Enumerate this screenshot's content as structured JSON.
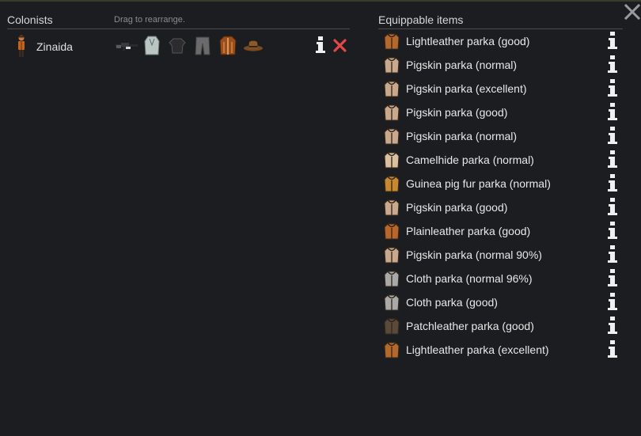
{
  "header": {
    "close_icon": "close-icon"
  },
  "colonists_panel": {
    "title": "Colonists",
    "hint": "Drag to rearrange.",
    "colonists": [
      {
        "name": "Zinaida",
        "gear_icons": [
          "rifle-icon",
          "vest-icon",
          "shirt-icon",
          "pants-icon",
          "parka-icon",
          "cowboy-hat-icon"
        ]
      }
    ]
  },
  "items_panel": {
    "title": "Equippable items",
    "items": [
      {
        "label": "Lightleather parka (good)",
        "color": "#b4692c"
      },
      {
        "label": "Pigskin parka (normal)",
        "color": "#c9a98d"
      },
      {
        "label": "Pigskin parka (excellent)",
        "color": "#c9a98d"
      },
      {
        "label": "Pigskin parka (good)",
        "color": "#c9a98d"
      },
      {
        "label": "Pigskin parka (normal)",
        "color": "#c9a98d"
      },
      {
        "label": "Camelhide parka (normal)",
        "color": "#d8c0a0"
      },
      {
        "label": "Guinea pig fur parka (normal)",
        "color": "#c6892f"
      },
      {
        "label": "Pigskin parka (good)",
        "color": "#c9a98d"
      },
      {
        "label": "Plainleather parka (good)",
        "color": "#b8662a"
      },
      {
        "label": "Pigskin parka (normal 90%)",
        "color": "#c9a98d"
      },
      {
        "label": "Cloth parka (normal 96%)",
        "color": "#a9a9a9"
      },
      {
        "label": "Cloth parka (good)",
        "color": "#a9a9a9"
      },
      {
        "label": "Patchleather parka (good)",
        "color": "#5a4a3c"
      },
      {
        "label": "Lightleather parka (excellent)",
        "color": "#b4692c"
      }
    ]
  }
}
